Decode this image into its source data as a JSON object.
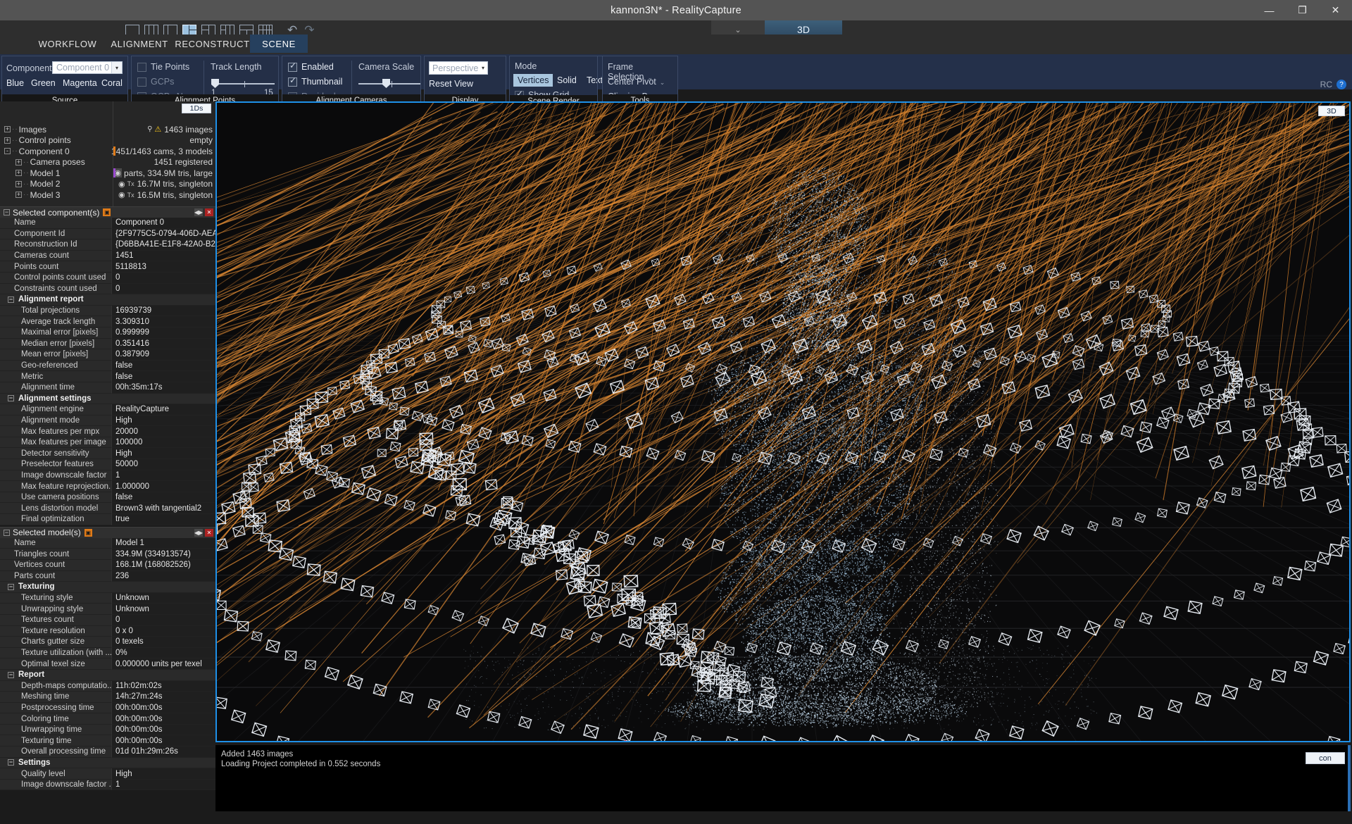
{
  "window": {
    "title": "kannon3N* - RealityCapture",
    "minimize": "—",
    "maximize": "❐",
    "close": "✕",
    "rc_label": "RC",
    "help_icon": "help-icon"
  },
  "toolstrip": {
    "layout_icons": [
      "layout-single",
      "layout-three-col",
      "layout-left-split",
      "layout-right-split",
      "layout-quad-a",
      "layout-quad-b",
      "layout-top-split",
      "layout-grid"
    ],
    "undo": "↶",
    "redo": "↷",
    "overflow_chevron": "⌄",
    "view_tab": "3D"
  },
  "ribbon": {
    "tabs": [
      {
        "label": "WORKFLOW",
        "active": false
      },
      {
        "label": "ALIGNMENT",
        "active": false
      },
      {
        "label": "RECONSTRUCTION",
        "active": false
      },
      {
        "label": "SCENE",
        "active": true
      }
    ],
    "groups": [
      {
        "label": "Source"
      },
      {
        "label": "Alignment Points"
      },
      {
        "label": "Alignment Cameras"
      },
      {
        "label": "Display"
      },
      {
        "label": "Scene Render"
      },
      {
        "label": "Tools"
      }
    ],
    "source": {
      "component_label": "Component",
      "component_value": "Component 0",
      "dropdown_arrow": "▾",
      "colors": [
        "Blue",
        "Green",
        "Magenta",
        "Coral"
      ]
    },
    "alignment_points": {
      "tie_points": "Tie Points",
      "gcps": "GCPs",
      "gcps_names": "GCPs Names",
      "track_length_label": "Track Length",
      "track_min": "1",
      "track_max": "15"
    },
    "alignment_cameras": {
      "enabled": "Enabled",
      "thumbnail": "Thumbnail",
      "residuals": "Residuals",
      "camera_scale_label": "Camera Scale"
    },
    "display": {
      "projection_value": "Perspective",
      "dropdown_arrow": "▾",
      "reset_view": "Reset View"
    },
    "scene_render": {
      "mode_label": "Mode",
      "modes": [
        "Vertices",
        "Solid",
        "Textured"
      ],
      "selected_mode": "Vertices",
      "show_grid": "Show Grid"
    },
    "tools": {
      "frame_selection": "Frame Selection",
      "center_pivot": "Center Pivot",
      "clipping_box": "Clipping Box",
      "chevron": "⌄"
    }
  },
  "tree": {
    "badge": "1Ds",
    "rows": [
      {
        "label": "Images",
        "indent": 0,
        "expander": "+",
        "right": "1463 images",
        "icons": "pin-warning",
        "bar": ""
      },
      {
        "label": "Control points",
        "indent": 0,
        "expander": "+",
        "right": "empty",
        "icons": "",
        "bar": ""
      },
      {
        "label": "Component 0",
        "indent": 0,
        "expander": "-",
        "right": "1451/1463 cams, 3 models",
        "icons": "",
        "bar": "#e07b18"
      },
      {
        "label": "Camera poses",
        "indent": 1,
        "expander": "+",
        "right": "1451 registered",
        "icons": "",
        "bar": ""
      },
      {
        "label": "Model 1",
        "indent": 1,
        "expander": "+",
        "right": "parts, 334.9M tris, large",
        "icons": "eye-hl",
        "bar": "#9b4ad0"
      },
      {
        "label": "Model 2",
        "indent": 1,
        "expander": "+",
        "right": "16.7M tris, singleton",
        "icons": "eye-tx",
        "bar": ""
      },
      {
        "label": "Model 3",
        "indent": 1,
        "expander": "+",
        "right": "16.5M tris, singleton",
        "icons": "eye-tx",
        "bar": ""
      }
    ]
  },
  "component_panel": {
    "title": "Selected component(s)",
    "pin_icon": "pin-icon",
    "collapse_icon": "−",
    "dock_icon": "◀▶",
    "close_icon": "✕",
    "rows": [
      {
        "k": "Name",
        "v": "Component 0",
        "type": "prop"
      },
      {
        "k": "Component Id",
        "v": "{2F9775C5-0794-406D-AEA8...",
        "type": "prop"
      },
      {
        "k": "Reconstruction Id",
        "v": "{D6BBA41E-E1F8-42A0-B29...",
        "type": "prop"
      },
      {
        "k": "Cameras count",
        "v": "1451",
        "type": "prop"
      },
      {
        "k": "Points count",
        "v": "5118813",
        "type": "prop"
      },
      {
        "k": "Control points count used",
        "v": "0",
        "type": "prop"
      },
      {
        "k": "Constraints count used",
        "v": "0",
        "type": "prop"
      },
      {
        "k": "Alignment report",
        "v": "",
        "type": "section"
      },
      {
        "k": "Total projections",
        "v": "16939739",
        "type": "prop2"
      },
      {
        "k": "Average track length",
        "v": "3.309310",
        "type": "prop2"
      },
      {
        "k": "Maximal error [pixels]",
        "v": "0.999999",
        "type": "prop2"
      },
      {
        "k": "Median error [pixels]",
        "v": "0.351416",
        "type": "prop2"
      },
      {
        "k": "Mean error [pixels]",
        "v": "0.387909",
        "type": "prop2"
      },
      {
        "k": "Geo-referenced",
        "v": "false",
        "type": "prop2"
      },
      {
        "k": "Metric",
        "v": "false",
        "type": "prop2"
      },
      {
        "k": "Alignment time",
        "v": "00h:35m:17s",
        "type": "prop2"
      },
      {
        "k": "Alignment settings",
        "v": "",
        "type": "section"
      },
      {
        "k": "Alignment engine",
        "v": "RealityCapture",
        "type": "prop2"
      },
      {
        "k": "Alignment mode",
        "v": "High",
        "type": "prop2"
      },
      {
        "k": "Max features per mpx",
        "v": "20000",
        "type": "prop2"
      },
      {
        "k": "Max features per image",
        "v": "100000",
        "type": "prop2"
      },
      {
        "k": "Detector sensitivity",
        "v": "High",
        "type": "prop2"
      },
      {
        "k": "Preselector features",
        "v": "50000",
        "type": "prop2"
      },
      {
        "k": "Image downscale factor",
        "v": "1",
        "type": "prop2"
      },
      {
        "k": "Max feature reprojection...",
        "v": "1.000000",
        "type": "prop2"
      },
      {
        "k": "Use camera positions",
        "v": "false",
        "type": "prop2"
      },
      {
        "k": "Lens distortion model",
        "v": "Brown3 with tangential2",
        "type": "prop2"
      },
      {
        "k": "Final optimization",
        "v": "true",
        "type": "prop2"
      }
    ]
  },
  "model_panel": {
    "title": "Selected model(s)",
    "pin_icon": "pin-icon",
    "collapse_icon": "−",
    "dock_icon": "◀▶",
    "close_icon": "✕",
    "rows": [
      {
        "k": "Name",
        "v": "Model 1",
        "type": "prop"
      },
      {
        "k": "Triangles count",
        "v": "334.9M (334913574)",
        "type": "prop"
      },
      {
        "k": "Vertices count",
        "v": "168.1M (168082526)",
        "type": "prop"
      },
      {
        "k": "Parts count",
        "v": "236",
        "type": "prop"
      },
      {
        "k": "Texturing",
        "v": "",
        "type": "section"
      },
      {
        "k": "Texturing style",
        "v": "Unknown",
        "type": "prop2"
      },
      {
        "k": "Unwrapping style",
        "v": "Unknown",
        "type": "prop2"
      },
      {
        "k": "Textures count",
        "v": "0",
        "type": "prop2"
      },
      {
        "k": "Texture resolution",
        "v": "0 x 0",
        "type": "prop2"
      },
      {
        "k": "Charts gutter size",
        "v": "0 texels",
        "type": "prop2"
      },
      {
        "k": "Texture utilization (with ...",
        "v": "0%",
        "type": "prop2"
      },
      {
        "k": "Optimal texel size",
        "v": "0.000000 units per texel",
        "type": "prop2"
      },
      {
        "k": "Report",
        "v": "",
        "type": "section"
      },
      {
        "k": "Depth-maps computatio...",
        "v": "11h:02m:02s",
        "type": "prop2"
      },
      {
        "k": "Meshing time",
        "v": "14h:27m:24s",
        "type": "prop2"
      },
      {
        "k": "Postprocessing time",
        "v": "00h:00m:00s",
        "type": "prop2"
      },
      {
        "k": "Coloring time",
        "v": "00h:00m:00s",
        "type": "prop2"
      },
      {
        "k": "Unwrapping time",
        "v": "00h:00m:00s",
        "type": "prop2"
      },
      {
        "k": "Texturing time",
        "v": "00h:00m:00s",
        "type": "prop2"
      },
      {
        "k": "Overall processing time",
        "v": "01d 01h:29m:26s",
        "type": "prop2"
      },
      {
        "k": "Settings",
        "v": "",
        "type": "section"
      },
      {
        "k": "Quality level",
        "v": "High",
        "type": "prop2"
      },
      {
        "k": "Image downscale factor ...",
        "v": "1",
        "type": "prop2"
      }
    ]
  },
  "viewport": {
    "badge": "3D",
    "scene_description": "3D point cloud of a Kannon Buddhist statue with 1451 registered camera frustums and orange tie-point rays"
  },
  "console": {
    "lines": [
      "Added 1463 images",
      "Loading Project completed in 0.552 seconds"
    ],
    "button": "con"
  },
  "colors": {
    "accent_blue": "#1e90e8",
    "ribbon_bg": "#24304a",
    "titlebar": "#545454",
    "panel_bg": "#262626",
    "orange": "#e07b18",
    "statue_blue": "#a9c6e0",
    "ray_orange": "#e08b34"
  }
}
